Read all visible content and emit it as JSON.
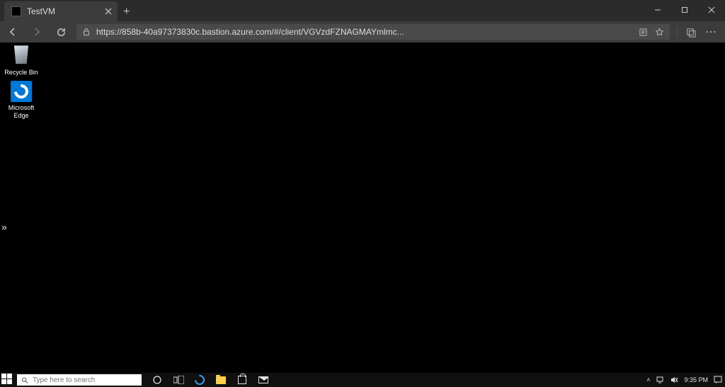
{
  "browser": {
    "tab_title": "TestVM",
    "url": "https://858b-40a97373830c.bastion.azure.com/#/client/VGVzdFZNAGMAYmlmc..."
  },
  "desktop": {
    "icons": [
      {
        "name": "recycle-bin",
        "label": "Recycle Bin"
      },
      {
        "name": "microsoft-edge",
        "label": "Microsoft\nEdge"
      }
    ]
  },
  "taskbar": {
    "search_placeholder": "Type here to search",
    "clock_time": "9:35 PM"
  }
}
